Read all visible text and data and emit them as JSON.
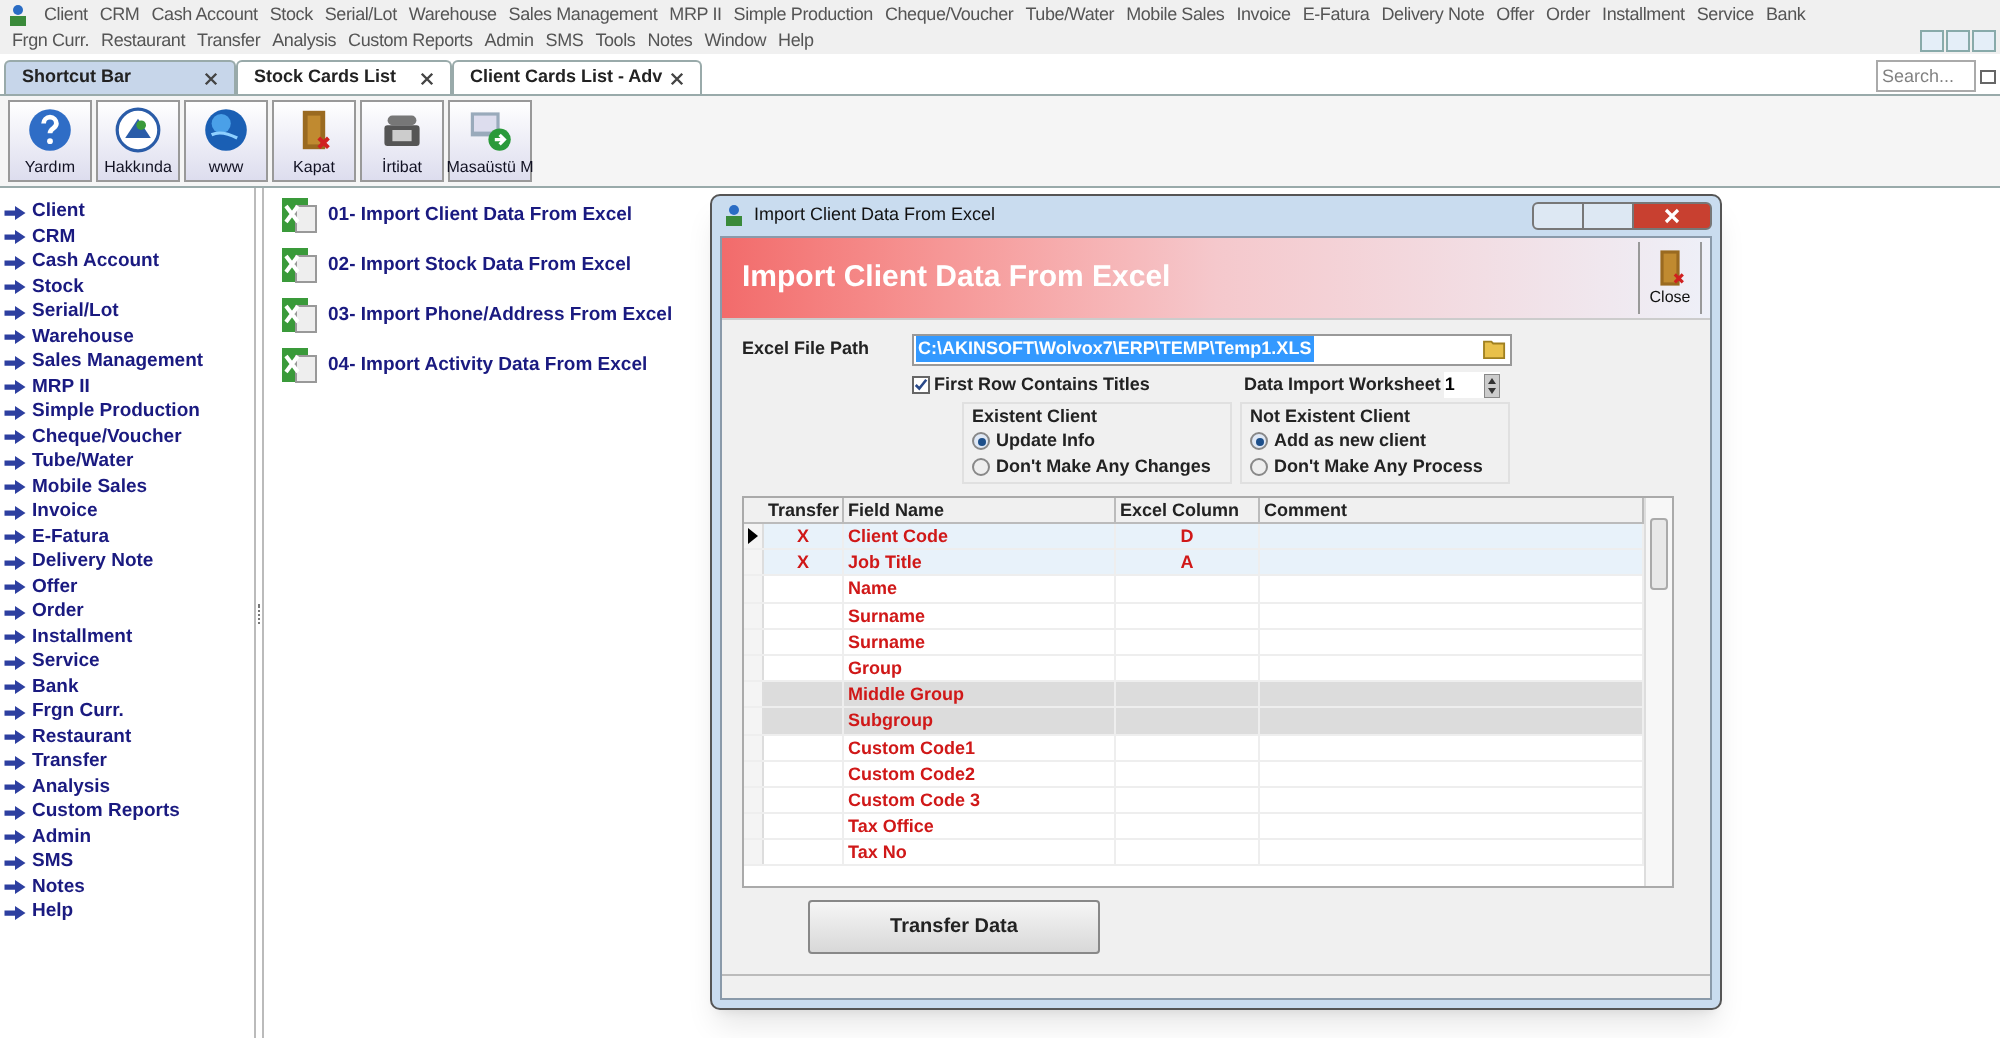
{
  "menu_rows": [
    [
      "Client",
      "CRM",
      "Cash Account",
      "Stock",
      "Serial/Lot",
      "Warehouse",
      "Sales Management",
      "MRP II",
      "Simple Production",
      "Cheque/Voucher",
      "Tube/Water",
      "Mobile Sales",
      "Invoice",
      "E-Fatura",
      "Delivery Note",
      "Offer",
      "Order",
      "Installment",
      "Service",
      "Bank"
    ],
    [
      "Frgn Curr.",
      "Restaurant",
      "Transfer",
      "Analysis",
      "Custom Reports",
      "Admin",
      "SMS",
      "Tools",
      "Notes",
      "Window",
      "Help"
    ]
  ],
  "tabs": [
    {
      "label": "Shortcut Bar",
      "selected": true
    },
    {
      "label": "Stock Cards List",
      "selected": false
    },
    {
      "label": "Client Cards List - Adv",
      "selected": false
    }
  ],
  "search": {
    "placeholder": "Search..."
  },
  "toolbar": [
    {
      "label": "Yardım",
      "kind": "help"
    },
    {
      "label": "Hakkında",
      "kind": "about"
    },
    {
      "label": "www",
      "kind": "globe"
    },
    {
      "label": "Kapat",
      "kind": "door"
    },
    {
      "label": "İrtibat",
      "kind": "phone"
    },
    {
      "label": "Masaüstü M",
      "kind": "desktop"
    }
  ],
  "sidebar": {
    "items": [
      "Client",
      "CRM",
      "Cash Account",
      "Stock",
      "Serial/Lot",
      "Warehouse",
      "Sales Management",
      "MRP II",
      "Simple Production",
      "Cheque/Voucher",
      "Tube/Water",
      "Mobile Sales",
      "Invoice",
      "E-Fatura",
      "Delivery Note",
      "Offer",
      "Order",
      "Installment",
      "Service",
      "Bank",
      "Frgn Curr.",
      "Restaurant",
      "Transfer",
      "Analysis",
      "Custom Reports",
      "Admin",
      "SMS",
      "Notes",
      "Help"
    ]
  },
  "shortcuts": [
    "01- Import Client Data From Excel",
    "02- Import Stock Data From Excel",
    "03- Import Phone/Address From Excel",
    "04- Import Activity Data From Excel"
  ],
  "dialog": {
    "title": "Import Client Data From Excel",
    "header": "Import Client Data From Excel",
    "close_label": "Close",
    "file_path_label": "Excel File Path",
    "file_path": "C:\\AKINSOFT\\Wolvox7\\ERP\\TEMP\\Temp1.XLS",
    "first_row_titles": {
      "label": "First Row Contains Titles",
      "checked": true
    },
    "worksheet": {
      "label": "Data Import Worksheet",
      "value": "1"
    },
    "groups": [
      {
        "title": "Existent Client",
        "options": [
          {
            "label": "Update Info",
            "selected": true
          },
          {
            "label": "Don't Make Any Changes",
            "selected": false
          }
        ]
      },
      {
        "title": "Not Existent Client",
        "options": [
          {
            "label": "Add as new client",
            "selected": true
          },
          {
            "label": "Don't Make Any Process",
            "selected": false
          }
        ]
      }
    ],
    "table": {
      "columns": [
        "Transfer",
        "Field Name",
        "Excel Column",
        "Comment"
      ],
      "rows": [
        {
          "transfer": "X",
          "field_name": "Client Code",
          "excel_column": "D",
          "selected": true,
          "shaded": false
        },
        {
          "transfer": "X",
          "field_name": "Job Title",
          "excel_column": "A",
          "selected": false,
          "shaded": false
        },
        {
          "field_name": "Name",
          "selected": false,
          "shaded": false
        },
        {
          "field_name": "Surname",
          "selected": false,
          "shaded": false
        },
        {
          "field_name": "Surname",
          "selected": false,
          "shaded": false
        },
        {
          "field_name": "Group",
          "selected": false,
          "shaded": false
        },
        {
          "field_name": "Middle Group",
          "selected": false,
          "shaded": true
        },
        {
          "field_name": "Subgroup",
          "selected": false,
          "shaded": true
        },
        {
          "field_name": "Custom Code1",
          "selected": false,
          "shaded": false
        },
        {
          "field_name": "Custom Code2",
          "selected": false,
          "shaded": false
        },
        {
          "field_name": "Custom Code 3",
          "selected": false,
          "shaded": false
        },
        {
          "field_name": "Tax Office",
          "selected": false,
          "shaded": false
        },
        {
          "field_name": "Tax No",
          "selected": false,
          "shaded": false
        }
      ]
    },
    "button": "Transfer Data"
  }
}
